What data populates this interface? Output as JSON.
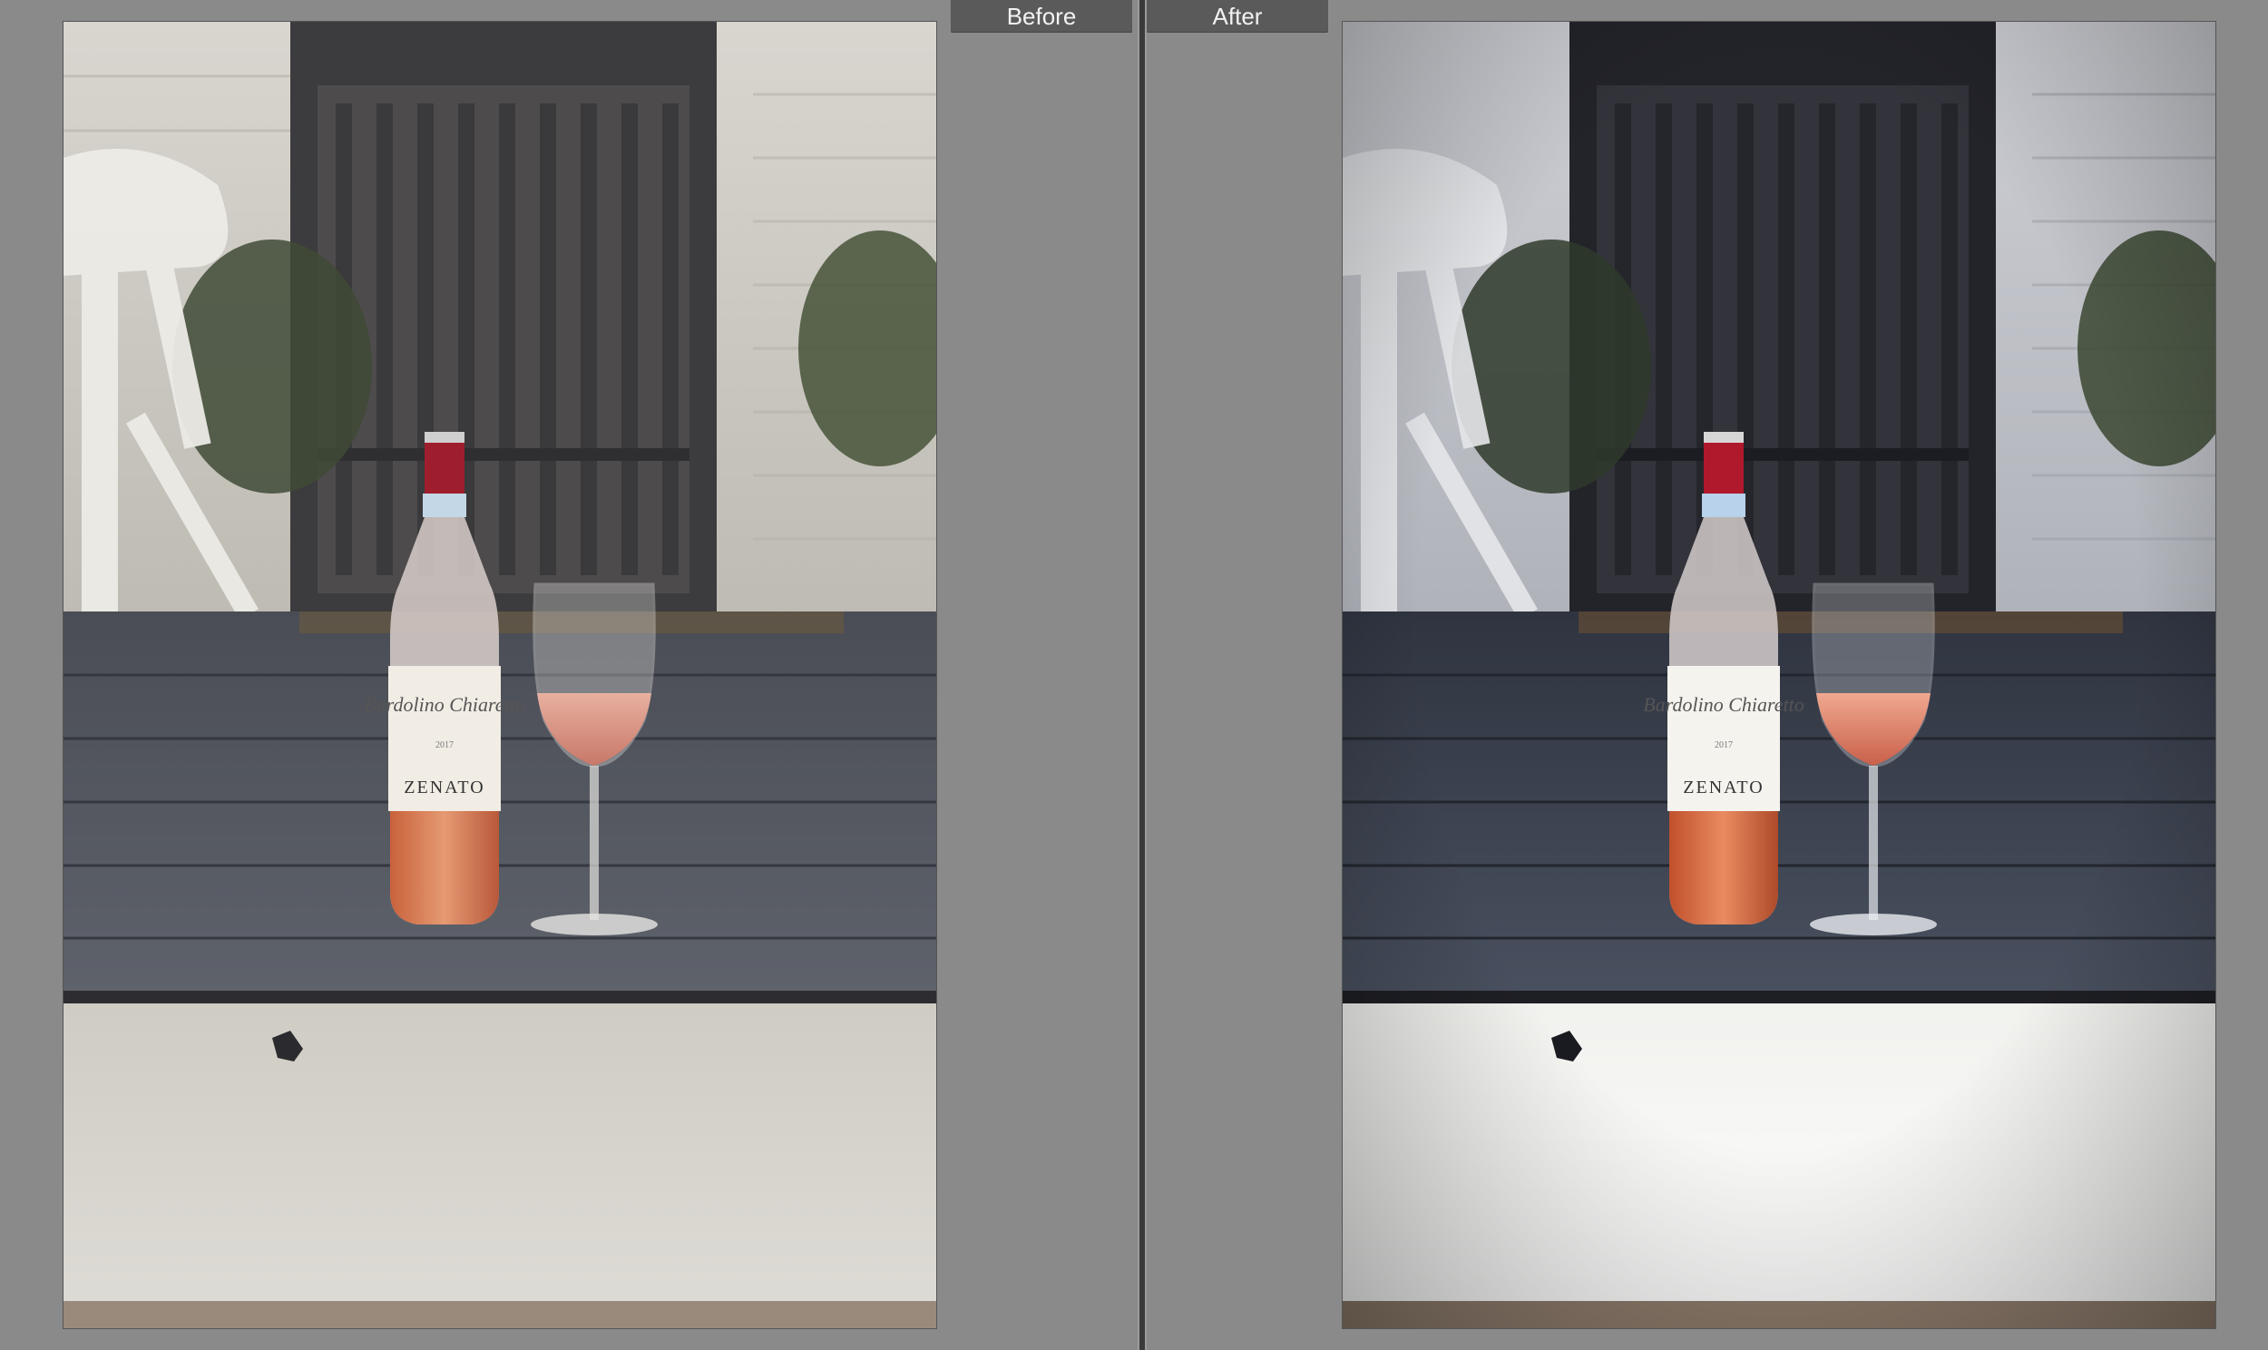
{
  "compare_view": {
    "before_label": "Before",
    "after_label": "After"
  },
  "photo": {
    "bottle_label_script": "Bardolino Chiaretto",
    "bottle_label_brand": "ZENATO",
    "bottle_label_year": "2017",
    "subject": "wine bottle and glass of rosé on porch step"
  },
  "colors": {
    "background": "#8a8a8a",
    "label_tab": "#5a5a5a",
    "divider": "#3a3a3a"
  }
}
